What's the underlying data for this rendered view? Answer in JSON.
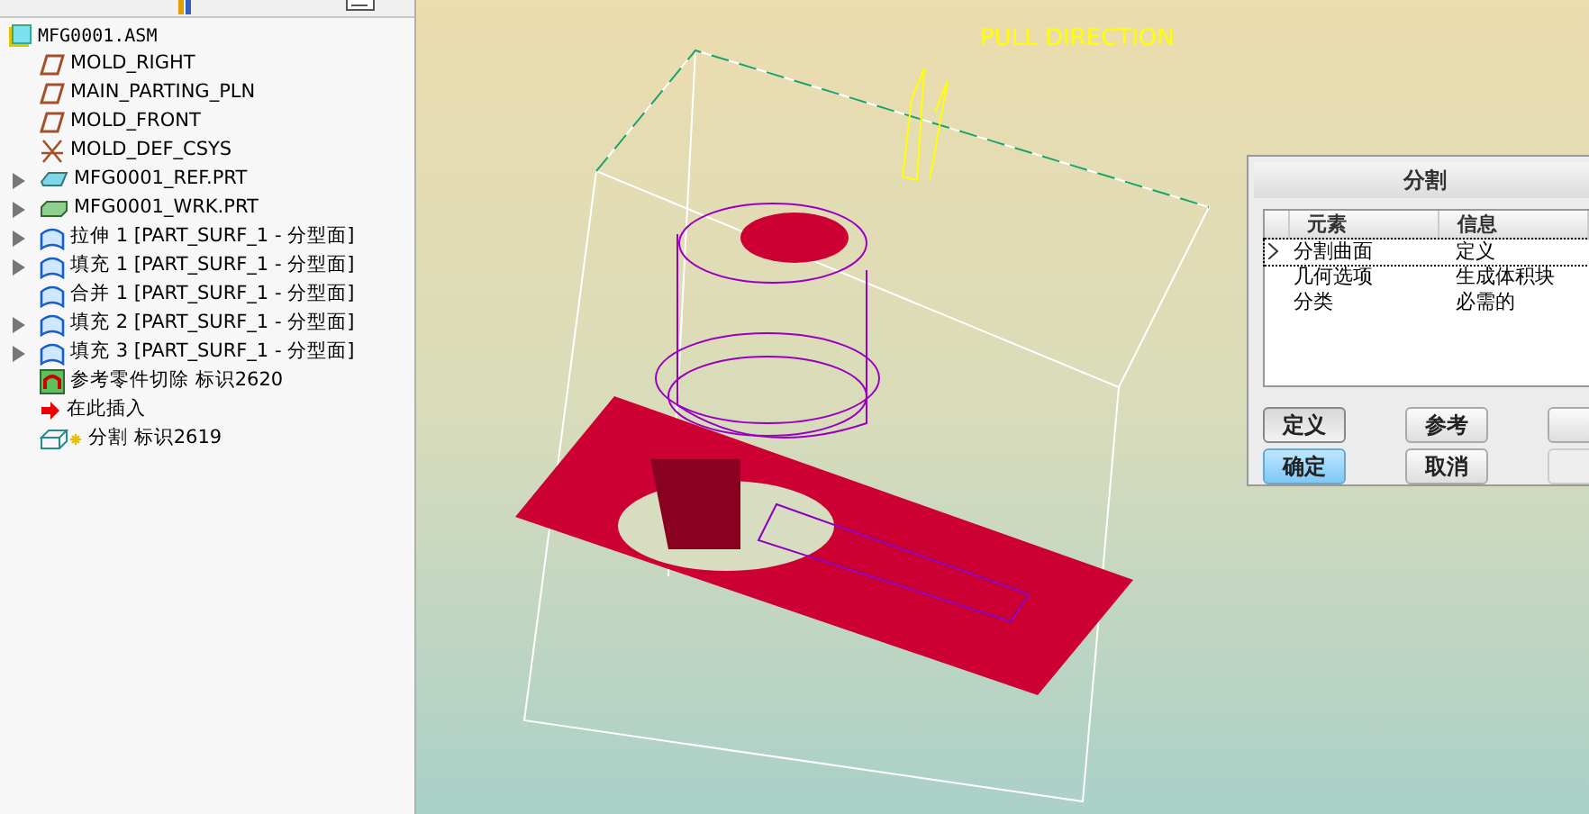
{
  "model_tree": {
    "root": {
      "label": "MFG0001.ASM",
      "kind": "assembly"
    },
    "items": [
      {
        "label": "MOLD_RIGHT",
        "kind": "plane",
        "expandable": false
      },
      {
        "label": "MAIN_PARTING_PLN",
        "kind": "plane",
        "expandable": false
      },
      {
        "label": "MOLD_FRONT",
        "kind": "plane",
        "expandable": false
      },
      {
        "label": "MOLD_DEF_CSYS",
        "kind": "csys",
        "expandable": false
      },
      {
        "label": "MFG0001_REF.PRT",
        "kind": "refpart",
        "expandable": true
      },
      {
        "label": "MFG0001_WRK.PRT",
        "kind": "workpiece",
        "expandable": true
      },
      {
        "label": "拉伸 1 [PART_SURF_1 - 分型面]",
        "kind": "surface",
        "expandable": true
      },
      {
        "label": "填充 1 [PART_SURF_1 - 分型面]",
        "kind": "surface",
        "expandable": true
      },
      {
        "label": "合并 1 [PART_SURF_1 - 分型面]",
        "kind": "surface",
        "expandable": false
      },
      {
        "label": "填充 2 [PART_SURF_1 - 分型面]",
        "kind": "surface",
        "expandable": true
      },
      {
        "label": "填充 3 [PART_SURF_1 - 分型面]",
        "kind": "surface",
        "expandable": true
      },
      {
        "label": "参考零件切除 标识2620",
        "kind": "cutout",
        "expandable": false
      },
      {
        "label": "在此插入",
        "kind": "insert",
        "expandable": false
      },
      {
        "label": "分割 标识2619",
        "kind": "split",
        "expandable": false
      }
    ]
  },
  "viewport": {
    "label": "PULL DIRECTION"
  },
  "dialog": {
    "title": "分割",
    "columns": [
      "元素",
      "信息"
    ],
    "rows": [
      {
        "element": "分割曲面",
        "info": "定义",
        "selected": true
      },
      {
        "element": "几何选项",
        "info": "生成体积块",
        "selected": false
      },
      {
        "element": "分类",
        "info": "必需的",
        "selected": false
      }
    ],
    "buttons": [
      [
        {
          "label": "定义",
          "kind": "pressed",
          "disabled": false
        },
        {
          "label": "参考",
          "kind": "normal",
          "disabled": false
        },
        {
          "kind": "normal",
          "disabled": false
        }
      ],
      [
        {
          "label": "确定",
          "kind": "default",
          "disabled": false
        },
        {
          "label": "取消",
          "kind": "normal",
          "disabled": false
        },
        {
          "kind": "normal",
          "disabled": true
        }
      ]
    ]
  }
}
